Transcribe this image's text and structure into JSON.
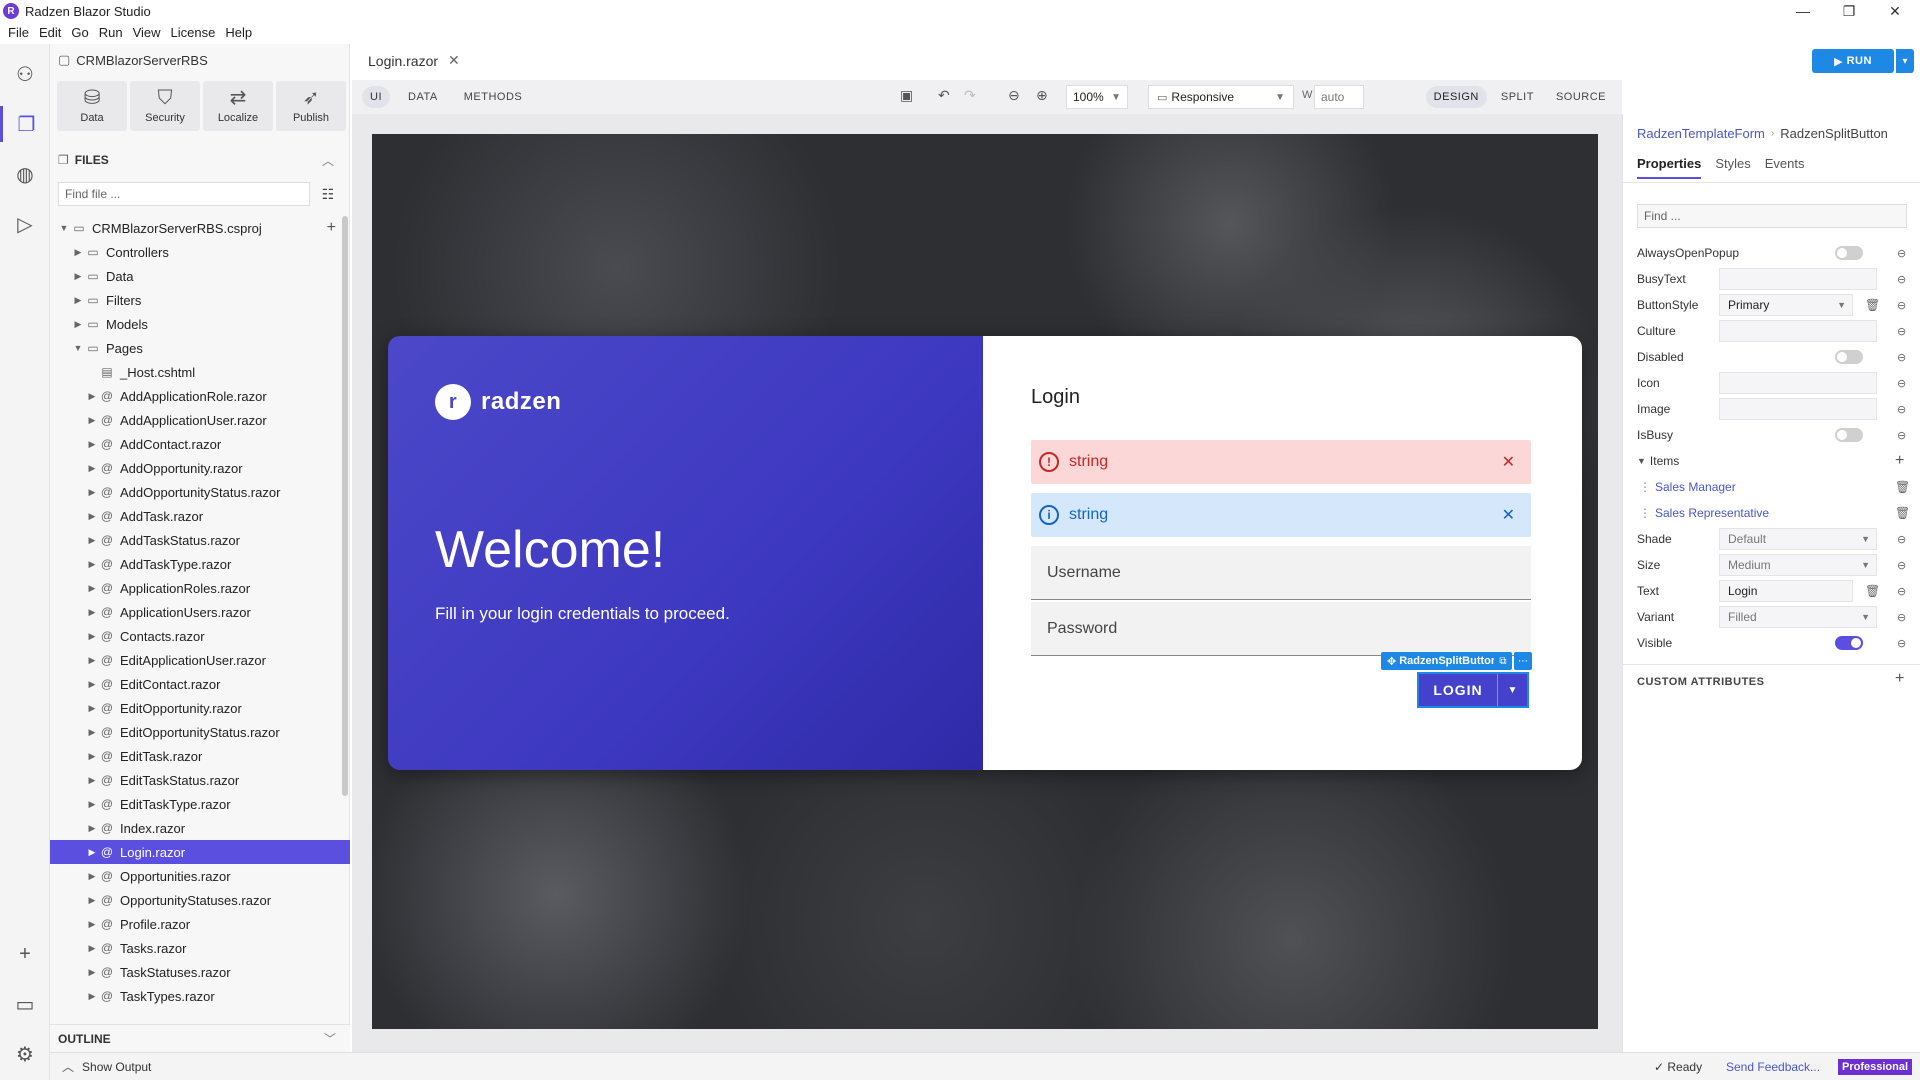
{
  "window": {
    "title": "Radzen Blazor Studio",
    "minimize": "—",
    "maximize": "❐",
    "close": "✕"
  },
  "menu": [
    "File",
    "Edit",
    "Go",
    "Run",
    "View",
    "License",
    "Help"
  ],
  "project": {
    "name": "CRMBlazorServerRBS",
    "tools": [
      {
        "label": "Data",
        "icon": "database-icon"
      },
      {
        "label": "Security",
        "icon": "shield-icon"
      },
      {
        "label": "Localize",
        "icon": "translate-icon"
      },
      {
        "label": "Publish",
        "icon": "rocket-icon"
      }
    ]
  },
  "files": {
    "header": "FILES",
    "find_placeholder": "Find file ...",
    "tree": [
      {
        "label": "CRMBlazorServerRBS.csproj",
        "depth": 0,
        "type": "folder",
        "expanded": true
      },
      {
        "label": "Controllers",
        "depth": 1,
        "type": "folder"
      },
      {
        "label": "Data",
        "depth": 1,
        "type": "folder"
      },
      {
        "label": "Filters",
        "depth": 1,
        "type": "folder"
      },
      {
        "label": "Models",
        "depth": 1,
        "type": "folder"
      },
      {
        "label": "Pages",
        "depth": 1,
        "type": "folder",
        "expanded": true
      },
      {
        "label": "_Host.cshtml",
        "depth": 2,
        "type": "file"
      },
      {
        "label": "AddApplicationRole.razor",
        "depth": 2,
        "type": "razor"
      },
      {
        "label": "AddApplicationUser.razor",
        "depth": 2,
        "type": "razor"
      },
      {
        "label": "AddContact.razor",
        "depth": 2,
        "type": "razor"
      },
      {
        "label": "AddOpportunity.razor",
        "depth": 2,
        "type": "razor"
      },
      {
        "label": "AddOpportunityStatus.razor",
        "depth": 2,
        "type": "razor"
      },
      {
        "label": "AddTask.razor",
        "depth": 2,
        "type": "razor"
      },
      {
        "label": "AddTaskStatus.razor",
        "depth": 2,
        "type": "razor"
      },
      {
        "label": "AddTaskType.razor",
        "depth": 2,
        "type": "razor"
      },
      {
        "label": "ApplicationRoles.razor",
        "depth": 2,
        "type": "razor"
      },
      {
        "label": "ApplicationUsers.razor",
        "depth": 2,
        "type": "razor"
      },
      {
        "label": "Contacts.razor",
        "depth": 2,
        "type": "razor"
      },
      {
        "label": "EditApplicationUser.razor",
        "depth": 2,
        "type": "razor"
      },
      {
        "label": "EditContact.razor",
        "depth": 2,
        "type": "razor"
      },
      {
        "label": "EditOpportunity.razor",
        "depth": 2,
        "type": "razor"
      },
      {
        "label": "EditOpportunityStatus.razor",
        "depth": 2,
        "type": "razor"
      },
      {
        "label": "EditTask.razor",
        "depth": 2,
        "type": "razor"
      },
      {
        "label": "EditTaskStatus.razor",
        "depth": 2,
        "type": "razor"
      },
      {
        "label": "EditTaskType.razor",
        "depth": 2,
        "type": "razor"
      },
      {
        "label": "Index.razor",
        "depth": 2,
        "type": "razor"
      },
      {
        "label": "Login.razor",
        "depth": 2,
        "type": "razor",
        "selected": true
      },
      {
        "label": "Opportunities.razor",
        "depth": 2,
        "type": "razor"
      },
      {
        "label": "OpportunityStatuses.razor",
        "depth": 2,
        "type": "razor"
      },
      {
        "label": "Profile.razor",
        "depth": 2,
        "type": "razor"
      },
      {
        "label": "Tasks.razor",
        "depth": 2,
        "type": "razor"
      },
      {
        "label": "TaskStatuses.razor",
        "depth": 2,
        "type": "razor"
      },
      {
        "label": "TaskTypes.razor",
        "depth": 2,
        "type": "razor"
      }
    ]
  },
  "outline": {
    "header": "OUTLINE"
  },
  "status": {
    "show_output": "Show Output",
    "ready": "Ready",
    "feedback": "Send Feedback...",
    "edition": "Professional"
  },
  "editor": {
    "tab": "Login.razor",
    "modes": [
      "UI",
      "DATA",
      "METHODS"
    ],
    "zoom": "100%",
    "device": "Responsive",
    "width_label": "W",
    "width_value": "auto",
    "views": [
      "DESIGN",
      "SPLIT",
      "SOURCE"
    ],
    "run_label": "RUN"
  },
  "login": {
    "brand": "radzen",
    "welcome": "Welcome!",
    "subtitle": "Fill in your login credentials to proceed.",
    "title": "Login",
    "error_text": "string",
    "info_text": "string",
    "username_placeholder": "Username",
    "password_placeholder": "Password",
    "component_tag": "RadzenSplitButton",
    "button_text": "LOGIN"
  },
  "properties": {
    "breadcrumb_parent": "RadzenTemplateForm",
    "breadcrumb_current": "RadzenSplitButton",
    "tabs": [
      "Properties",
      "Styles",
      "Events"
    ],
    "find_placeholder": "Find ...",
    "rows": {
      "always_open_popup": "AlwaysOpenPopup",
      "busy_text": "BusyText",
      "button_style": "ButtonStyle",
      "button_style_value": "Primary",
      "culture": "Culture",
      "disabled": "Disabled",
      "icon": "Icon",
      "image": "Image",
      "is_busy": "IsBusy",
      "items": "Items",
      "item_1": "Sales Manager",
      "item_2": "Sales Representative",
      "shade": "Shade",
      "shade_value": "Default",
      "size": "Size",
      "size_value": "Medium",
      "text": "Text",
      "text_value": "Login",
      "variant": "Variant",
      "variant_value": "Filled",
      "visible": "Visible"
    },
    "custom_attributes": "CUSTOM ATTRIBUTES"
  },
  "colors": {
    "accent": "#5b4fe0",
    "run": "#1e88e5",
    "brand_gradient_start": "#4c48c9",
    "error_bg": "#fbd7d7",
    "info_bg": "#d5e8fb"
  }
}
